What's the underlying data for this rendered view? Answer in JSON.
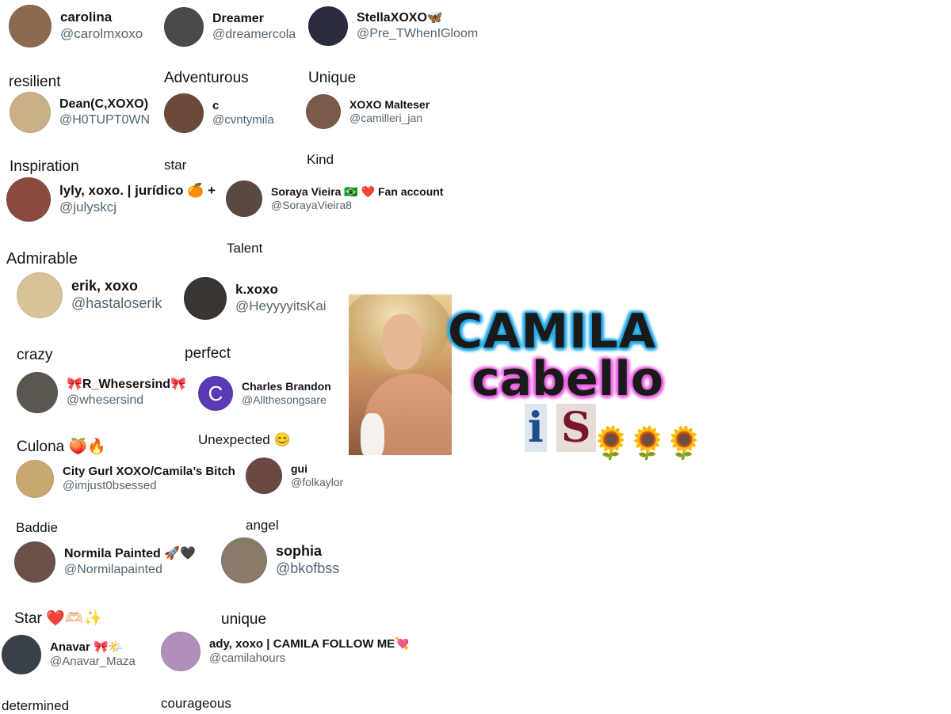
{
  "cards": [
    {
      "name": "carolina",
      "handle": "@carolmxoxo",
      "avatar_color": "#8a6a52"
    },
    {
      "name": "Dreamer",
      "handle": "@dreamercola",
      "avatar_color": "#4a4a4a"
    },
    {
      "name": "StellaXOXO🦋",
      "handle": "@Pre_TWhenIGloom",
      "avatar_color": "#2b2b40"
    },
    {
      "name": "Dean(C,XOXO)",
      "handle": "@H0TUPT0WN",
      "avatar_color": "#c9b089"
    },
    {
      "name": "c",
      "handle": "@cvntymila",
      "avatar_color": "#6b4a3a"
    },
    {
      "name": "XOXO Malteser",
      "handle": "@camilleri_jan",
      "avatar_color": "#7a5a48"
    },
    {
      "name": "lyly, xoxo. | jurídico 🍊 +",
      "handle": "@julyskcj",
      "avatar_color": "#8a4a40"
    },
    {
      "name": "Soraya Vieira 🇧🇷 ❤️ Fan account",
      "handle": "@SorayaVieira8",
      "avatar_color": "#5a4a42"
    },
    {
      "name": "erik, xoxo",
      "handle": "@hastaloserik",
      "avatar_color": "#d8c29a"
    },
    {
      "name": "k.xoxo",
      "handle": "@HeyyyyitsKai",
      "avatar_color": "#3a3432"
    },
    {
      "name": "🎀R_Whesersind🎀",
      "handle": "@whesersind",
      "avatar_color": "#5b5650"
    },
    {
      "name": "Charles Brandon",
      "handle": "@Allthesongsare",
      "avatar_letter": "C",
      "avatar_color": "#5a3bb5"
    },
    {
      "name": "City Gurl XOXO/Camila’s Bitch",
      "handle": "@imjust0bsessed",
      "avatar_color": "#c8a870"
    },
    {
      "name": "gui",
      "handle": "@folkaylor",
      "avatar_color": "#6a4a40"
    },
    {
      "name": "Normila Painted 🚀🖤",
      "handle": "@Normilapainted",
      "avatar_color": "#6a5048"
    },
    {
      "name": "sophia",
      "handle": "@bkofbss",
      "avatar_color": "#8a7a6a"
    },
    {
      "name": "Anavar 🎀🌤️",
      "handle": "@Anavar_Maza",
      "avatar_color": "#3a4048"
    },
    {
      "name": "ady, xoxo | CAMILA FOLLOW ME💘",
      "handle": "@camilahours",
      "avatar_color": "#b090b8"
    }
  ],
  "words": [
    "resilient",
    "Adventurous",
    "Unique",
    "Inspiration",
    "star",
    "Kind",
    "Talent",
    "Admirable",
    "crazy",
    "perfect",
    "Culona 🍑🔥",
    "Unexpected 😊",
    "Baddie",
    "angel",
    "Star ❤️🫶🏻✨",
    "unique",
    "determined",
    "courageous"
  ],
  "graphic": {
    "line1": "CAMILA",
    "line2": "cabello",
    "is_i": "i",
    "is_s": "S",
    "suns": [
      "🌻",
      "🌻",
      "🌻"
    ],
    "accent_blue": "#23a8e8",
    "accent_pink": "#e860e0"
  }
}
